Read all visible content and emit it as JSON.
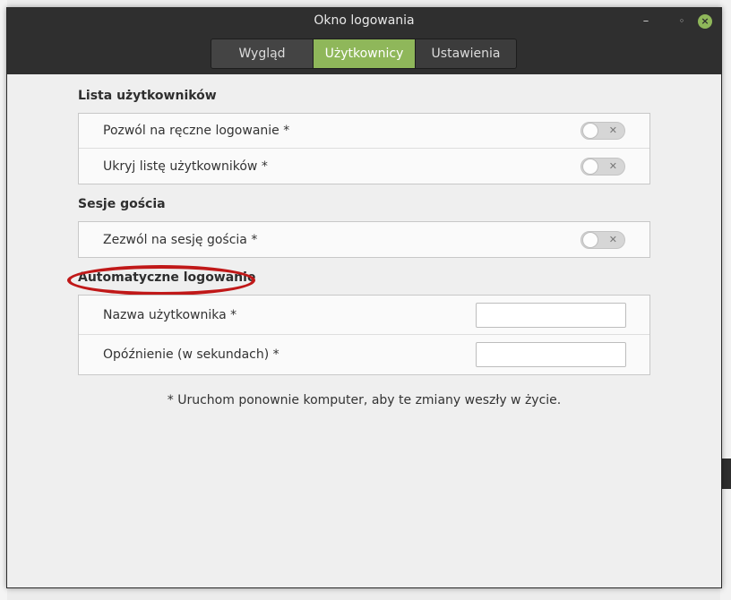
{
  "window": {
    "title": "Okno logowania"
  },
  "tabs": [
    {
      "label": "Wygląd",
      "active": false
    },
    {
      "label": "Użytkownicy",
      "active": true
    },
    {
      "label": "Ustawienia",
      "active": false
    }
  ],
  "sections": {
    "user_list": {
      "title": "Lista użytkowników",
      "rows": [
        {
          "label": "Pozwól na ręczne logowanie *",
          "enabled": false
        },
        {
          "label": "Ukryj listę użytkowników *",
          "enabled": false
        }
      ]
    },
    "guest": {
      "title": "Sesje gościa",
      "rows": [
        {
          "label": "Zezwól na sesję gościa *",
          "enabled": false
        }
      ]
    },
    "autologin": {
      "title": "Automatyczne logowanie",
      "rows": [
        {
          "label": "Nazwa użytkownika *",
          "value": ""
        },
        {
          "label": "Opóźnienie (w sekundach) *",
          "value": ""
        }
      ]
    }
  },
  "note": "* Uruchom ponownie komputer, aby te zmiany weszły w życie.",
  "colors": {
    "accent": "#8fb75a",
    "titlebar": "#2f2f2f",
    "highlight": "#c01818"
  }
}
